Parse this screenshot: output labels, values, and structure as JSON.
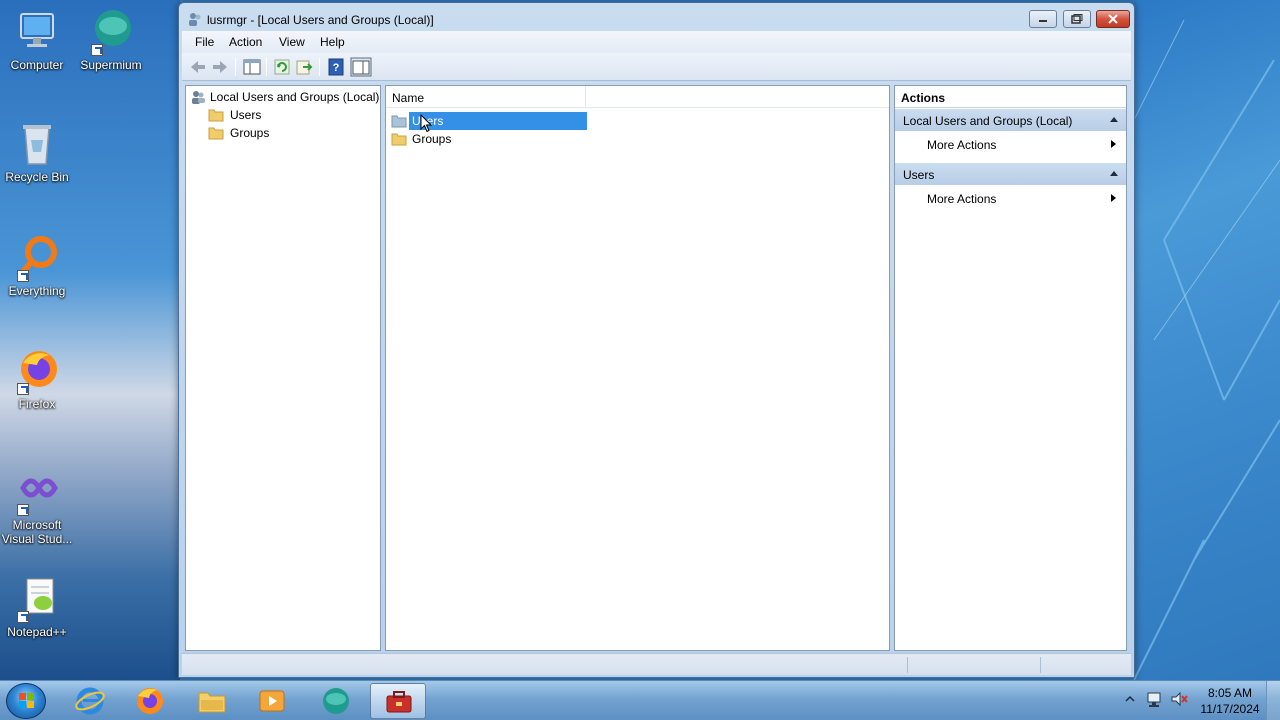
{
  "desktop": {
    "icons": [
      {
        "label": "Computer",
        "icon": "computer-icon"
      },
      {
        "label": "Supermium",
        "icon": "supermium-icon"
      },
      {
        "label": "Recycle Bin",
        "icon": "recycle-bin-icon"
      },
      {
        "label": "Everything",
        "icon": "everything-search-icon"
      },
      {
        "label": "Firefox",
        "icon": "firefox-icon"
      },
      {
        "label": "Microsoft Visual Stud...",
        "icon": "visual-studio-icon"
      },
      {
        "label": "Notepad++",
        "icon": "notepad-plus-plus-icon"
      }
    ]
  },
  "window": {
    "title": "lusrmgr - [Local Users and Groups (Local)]",
    "menu": [
      "File",
      "Action",
      "View",
      "Help"
    ],
    "toolbar_icons": [
      "back-icon",
      "forward-icon",
      "show-hide-tree-icon",
      "refresh-icon",
      "export-list-icon",
      "help-icon",
      "show-hide-action-pane-icon"
    ]
  },
  "tree": {
    "root": "Local Users and Groups (Local)",
    "children": [
      "Users",
      "Groups"
    ]
  },
  "list": {
    "column_name": "Name",
    "rows": [
      {
        "label": "Users",
        "selected": true
      },
      {
        "label": "Groups",
        "selected": false
      }
    ]
  },
  "actions": {
    "title": "Actions",
    "sections": [
      {
        "header": "Local Users and Groups (Local)",
        "item": "More Actions"
      },
      {
        "header": "Users",
        "item": "More Actions"
      }
    ]
  },
  "taskbar": {
    "apps": [
      "internet-explorer-icon",
      "firefox-icon",
      "file-explorer-icon",
      "media-player-icon",
      "supermium-icon",
      "computer-management-icon"
    ],
    "active_app": "computer-management-icon",
    "time": "8:05 AM",
    "date": "11/17/2024"
  },
  "colors": {
    "selection": "#3390e6",
    "action_section": "#c5d8ee"
  }
}
